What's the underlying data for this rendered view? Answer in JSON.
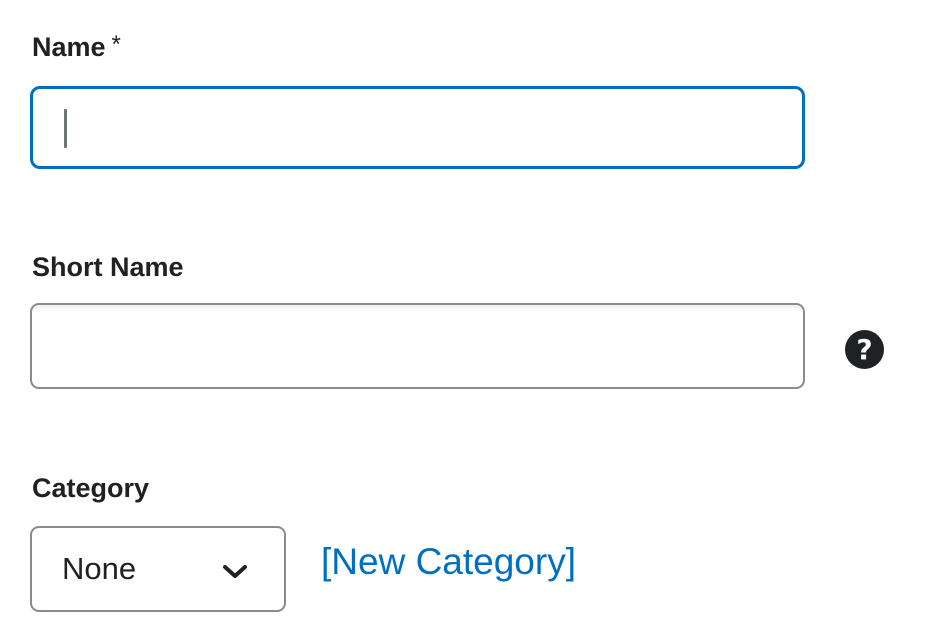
{
  "form": {
    "name": {
      "label": "Name",
      "required_mark": "*",
      "value": "",
      "placeholder": ""
    },
    "short_name": {
      "label": "Short Name",
      "value": "",
      "placeholder": "",
      "help_icon": "question-circle-icon",
      "help_glyph": "?"
    },
    "category": {
      "label": "Category",
      "selected": "None",
      "chevron_icon": "chevron-down-icon",
      "new_link": "[New Category]"
    }
  },
  "colors": {
    "focus_border": "#006fbf",
    "link": "#006fbf",
    "border": "#868c8f",
    "text": "#202122"
  }
}
